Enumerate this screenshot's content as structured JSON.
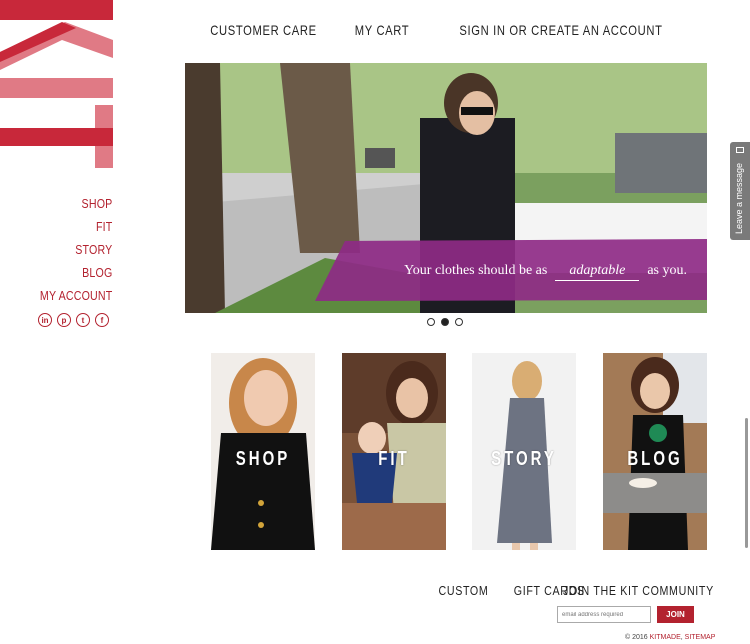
{
  "top_nav": {
    "customer_care": "CUSTOMER CARE",
    "my_cart": "MY CART",
    "sign_in": "SIGN IN OR CREATE AN ACCOUNT"
  },
  "side_nav": {
    "shop": "SHOP",
    "fit": "FIT",
    "story": "STORY",
    "blog": "BLOG",
    "my_account": "MY ACCOUNT"
  },
  "social": {
    "linkedin": "in",
    "pinterest": "p",
    "twitter": "t",
    "facebook": "f"
  },
  "hero": {
    "text_before": "Your clothes should be as",
    "text_emphasis": "adaptable",
    "text_after": "as you.",
    "slide_count": 3,
    "active_slide": 2
  },
  "tiles": [
    {
      "label": "SHOP"
    },
    {
      "label": "FIT"
    },
    {
      "label": "STORY"
    },
    {
      "label": "BLOG"
    }
  ],
  "footer": {
    "custom": "CUSTOM",
    "gift_cards": "GIFT CARDS",
    "community": "JOIN THE KIT COMMUNITY",
    "email_placeholder": "email address required",
    "join": "JOIN",
    "copyright_prefix": "© 2016",
    "kitmade": "KITMADE",
    "sitemap": "SITEMAP"
  },
  "message_tab": "Leave a message",
  "colors": {
    "brand_red": "#b3222f",
    "banner_purple": "#8e2a86"
  }
}
